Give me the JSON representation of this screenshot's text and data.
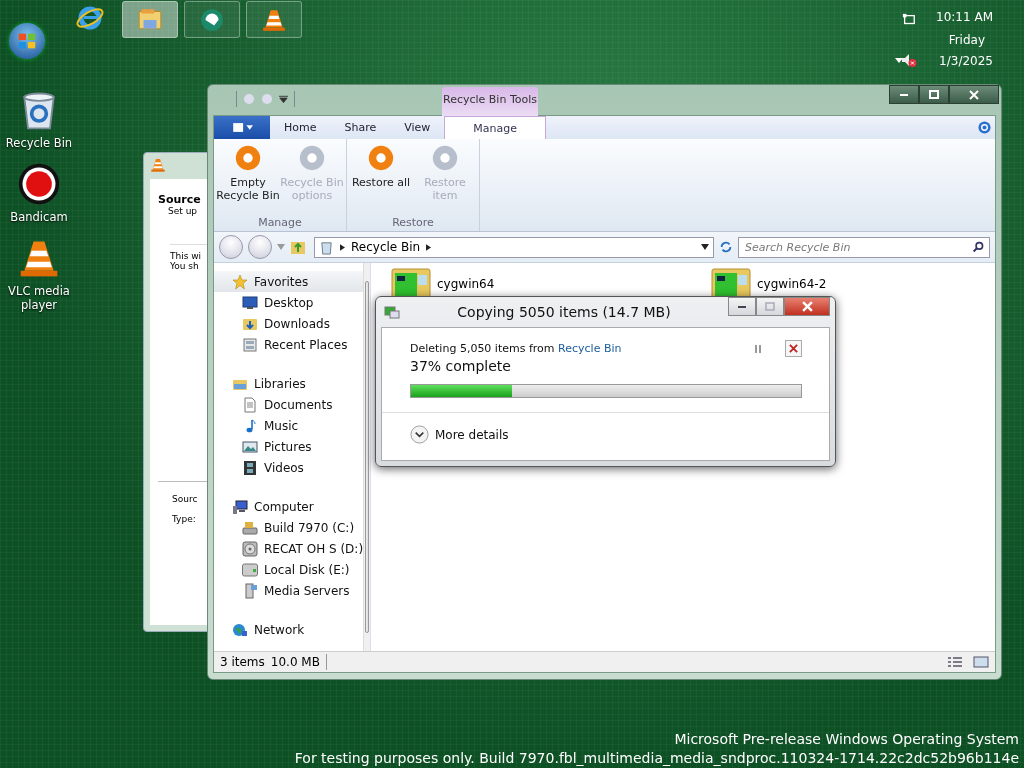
{
  "taskbar": {
    "buttons": [
      {
        "kind": "folder",
        "selected": true
      },
      {
        "kind": "swirl",
        "selected": false
      },
      {
        "kind": "cone",
        "selected": false
      }
    ]
  },
  "clock": {
    "time": "10:11 AM",
    "day": "Friday",
    "date": "1/3/2025"
  },
  "desktop_icons": [
    {
      "label": "Recycle Bin",
      "kind": "bin"
    },
    {
      "label": "Bandicam",
      "kind": "record"
    },
    {
      "label": "VLC media player",
      "kind": "cone"
    }
  ],
  "background_window": {
    "heading": "Source",
    "subheading": "Set up",
    "body": [
      "This wi",
      "You sh"
    ],
    "fields": [
      "Sourc",
      "Type:"
    ]
  },
  "explorer": {
    "context_tab": "Recycle Bin Tools",
    "ribbon_tabs": [
      {
        "label": "Home",
        "selected": false
      },
      {
        "label": "Share",
        "selected": false
      },
      {
        "label": "View",
        "selected": false
      },
      {
        "label": "Manage",
        "selected": true
      }
    ],
    "ribbon_groups": [
      {
        "label": "Manage",
        "commands": [
          {
            "label": "Empty Recycle Bin",
            "disabled": false
          },
          {
            "label": "Recycle Bin options",
            "disabled": true
          }
        ]
      },
      {
        "label": "Restore",
        "commands": [
          {
            "label": "Restore all",
            "disabled": false
          },
          {
            "label": "Restore item",
            "disabled": true
          }
        ]
      }
    ],
    "address": [
      "Recycle Bin"
    ],
    "search": {
      "placeholder": "Search Recycle Bin"
    },
    "nav": [
      {
        "label": "Favorites",
        "kind": "star",
        "selected": true,
        "children": [
          {
            "label": "Desktop",
            "kind": "desktop",
            "selected": false
          },
          {
            "label": "Downloads",
            "kind": "downloads",
            "selected": false
          },
          {
            "label": "Recent Places",
            "kind": "recent",
            "selected": false
          }
        ]
      },
      {
        "label": "Libraries",
        "kind": "library",
        "selected": false,
        "children": [
          {
            "label": "Documents",
            "kind": "document",
            "selected": false
          },
          {
            "label": "Music",
            "kind": "music",
            "selected": false
          },
          {
            "label": "Pictures",
            "kind": "picture",
            "selected": false
          },
          {
            "label": "Videos",
            "kind": "video",
            "selected": false
          }
        ]
      },
      {
        "label": "Computer",
        "kind": "computer",
        "selected": false,
        "children": [
          {
            "label": "Build 7970 (C:)",
            "kind": "drive",
            "selected": false
          },
          {
            "label": "RECAT OH S (D:)",
            "kind": "disc",
            "selected": false
          },
          {
            "label": "Local Disk (E:)",
            "kind": "disk",
            "selected": false
          },
          {
            "label": "Media Servers",
            "kind": "server",
            "selected": false
          }
        ]
      },
      {
        "label": "Network",
        "kind": "network",
        "selected": false
      }
    ],
    "items": [
      {
        "name": "cygwin64"
      },
      {
        "name": "cygwin64-2"
      }
    ],
    "status_bar": [
      "3 items",
      "10.0 MB"
    ]
  },
  "copy_dialog": {
    "title": "Copying 5050 items (14.7 MB)",
    "message": "Deleting 5,050 items from",
    "source_link": "Recycle Bin",
    "progress_text": "37% complete",
    "level": 0.26,
    "more_details": "More details"
  },
  "build_info": [
    "Microsoft Pre-release Windows Operating System",
    "For testing purposes only. Build 7970.fbl_multimedia_media_sndproc.110324-1714.22c2dc52b96b114e"
  ]
}
